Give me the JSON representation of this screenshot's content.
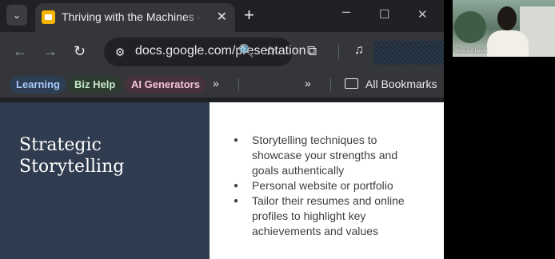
{
  "tab": {
    "title": "Thriving with the Machines - Google Slides",
    "new_tab_glyph": "+",
    "close_glyph": "✕"
  },
  "omnibox": {
    "url": "docs.google.com/presentation",
    "icons": [
      "site-info-icon",
      "zoom-icon",
      "star-icon"
    ]
  },
  "bookmarks": {
    "items": [
      {
        "label": "Learning",
        "color": "#a8c7fa"
      },
      {
        "label": "Biz Help",
        "color": "#c4e8c9"
      },
      {
        "label": "AI Generators",
        "color": "#f6c6d9"
      }
    ],
    "all_label": "All Bookmarks"
  },
  "slide": {
    "title": "Strategic Storytelling",
    "title_bg": "#2f3b4e",
    "bullets": [
      "Storytelling techniques to showcase your strengths and goals authentically",
      "Personal website or portfolio",
      "Tailor their resumes and online profiles to highlight key achievements and values"
    ]
  },
  "video": {
    "participant_name": "Allyssa A Lewis"
  }
}
